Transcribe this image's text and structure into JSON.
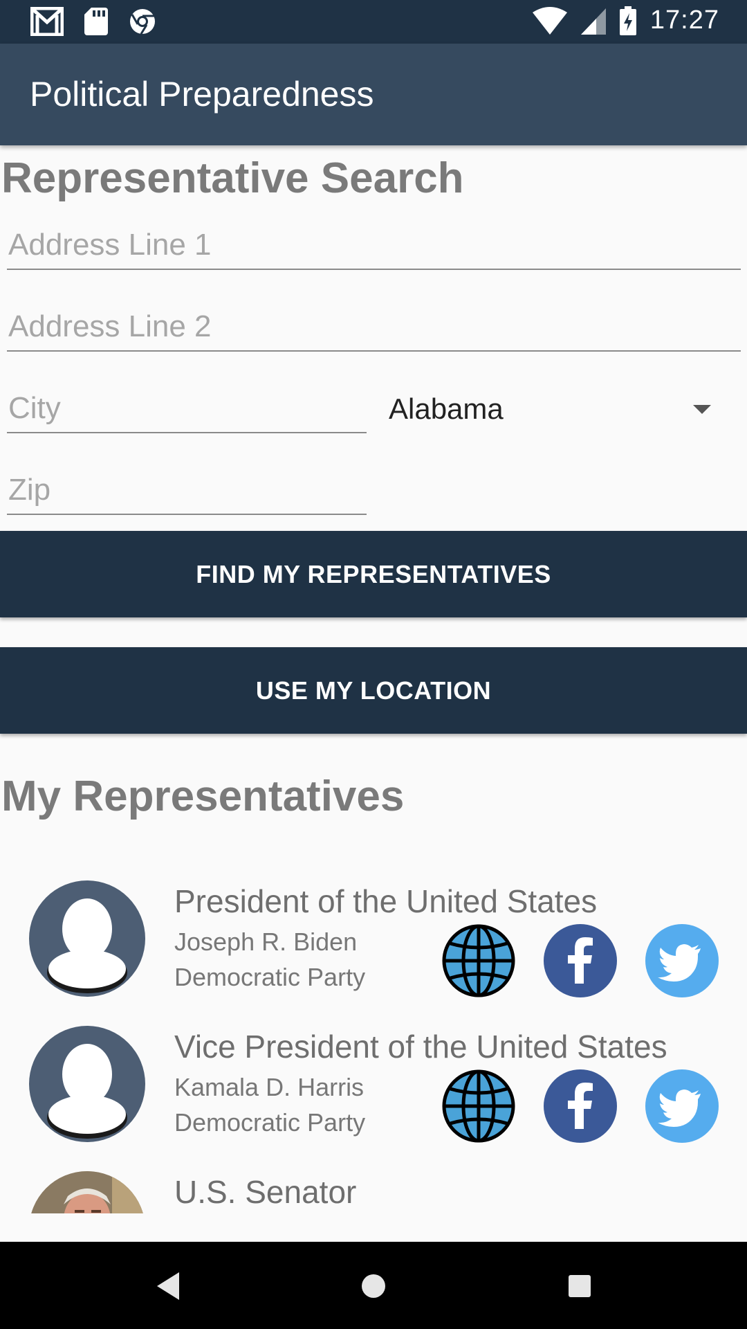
{
  "status_bar": {
    "time": "17:27",
    "left_icons": [
      "gmail-icon",
      "sd-card-icon",
      "chrome-icon"
    ],
    "right_icons": [
      "wifi-icon",
      "signal-icon",
      "battery-charging-icon"
    ]
  },
  "app_bar": {
    "title": "Political Preparedness",
    "color": "#364a5f"
  },
  "search": {
    "section_title": "Representative Search",
    "address_line_1": {
      "placeholder": "Address Line 1",
      "value": ""
    },
    "address_line_2": {
      "placeholder": "Address Line 2",
      "value": ""
    },
    "city": {
      "placeholder": "City",
      "value": ""
    },
    "zip": {
      "placeholder": "Zip",
      "value": ""
    },
    "state": {
      "selected": "Alabama"
    },
    "find_button_label": "FIND MY REPRESENTATIVES",
    "location_button_label": "USE MY LOCATION",
    "button_color": "#1f3245"
  },
  "representatives": {
    "section_title": "My Representatives",
    "items": [
      {
        "office": "President of the United States",
        "name": "Joseph R. Biden",
        "party": "Democratic Party",
        "avatar": "default-person-avatar",
        "links": [
          "website-globe-icon",
          "facebook-icon",
          "twitter-icon"
        ]
      },
      {
        "office": "Vice President of the United States",
        "name": "Kamala D. Harris",
        "party": "Democratic Party",
        "avatar": "default-person-avatar",
        "links": [
          "website-globe-icon",
          "facebook-icon",
          "twitter-icon"
        ]
      },
      {
        "office": "U.S. Senator",
        "avatar": "senator-photo"
      }
    ]
  },
  "nav_bar": {
    "buttons": [
      "back-icon",
      "home-icon",
      "recents-icon"
    ]
  }
}
